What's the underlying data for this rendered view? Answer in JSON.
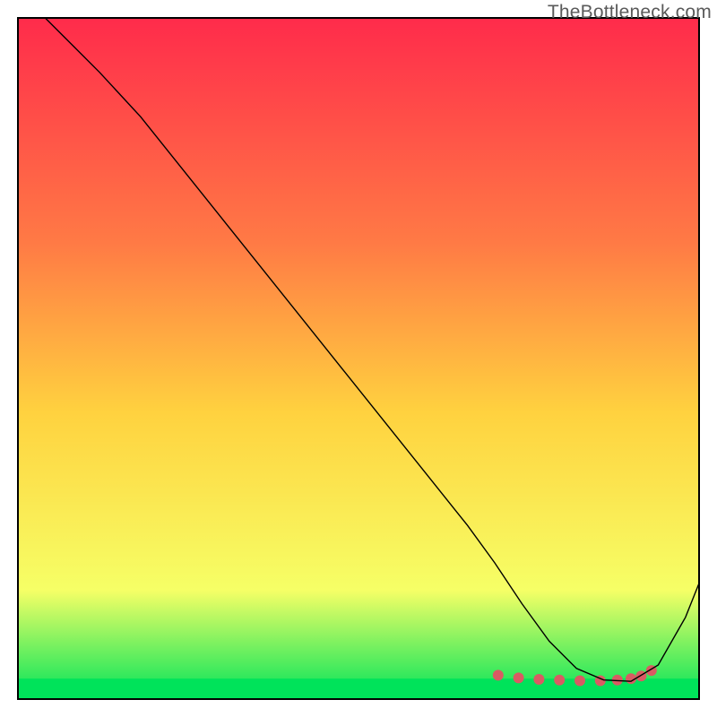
{
  "watermark": "TheBottleneck.com",
  "chart_data": {
    "type": "line",
    "title": "",
    "xlabel": "",
    "ylabel": "",
    "xlim": [
      0,
      100
    ],
    "ylim": [
      0,
      100
    ],
    "grid": false,
    "gradient_colors": {
      "top": "#ff2b4b",
      "mid_upper": "#ff7a45",
      "mid": "#ffd23f",
      "mid_lower": "#f6ff66",
      "bottom": "#00e35a"
    },
    "series": [
      {
        "name": "curve",
        "color": "#000000",
        "stroke_width": 1.4,
        "x": [
          4,
          8,
          12,
          18,
          24,
          30,
          36,
          42,
          48,
          54,
          60,
          66,
          70,
          74,
          78,
          82,
          86,
          90,
          94,
          98,
          100
        ],
        "y": [
          100,
          96,
          92,
          85.5,
          78,
          70.5,
          63,
          55.5,
          48,
          40.5,
          33,
          25.5,
          20,
          14,
          8.5,
          4.5,
          2.8,
          2.6,
          5,
          12,
          17
        ]
      },
      {
        "name": "dots",
        "color": "#d95b63",
        "marker_radius": 6,
        "x": [
          70.5,
          73.5,
          76.5,
          79.5,
          82.5,
          85.5,
          88.0,
          90.0,
          91.5,
          93.0
        ],
        "y": [
          3.5,
          3.1,
          2.9,
          2.8,
          2.7,
          2.7,
          2.8,
          3.0,
          3.4,
          4.2
        ]
      }
    ],
    "bottom_band": {
      "from_y": 0,
      "to_y": 3.0,
      "color": "#00e35a"
    }
  }
}
